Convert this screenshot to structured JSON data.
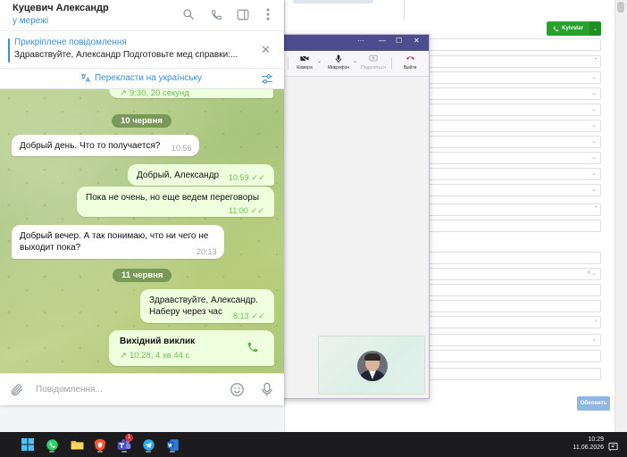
{
  "crm": {
    "call_button_label": "Kyivstar",
    "submit_label": "Обновить"
  },
  "call_window": {
    "title_controls": [
      "···",
      "—",
      "☐",
      "✕"
    ],
    "toolbar": {
      "camera_label": "Камера",
      "mic_label": "Микрофон",
      "share_label": "Поделиться",
      "leave_label": "Выйти"
    }
  },
  "telegram": {
    "header": {
      "contact_name": "Куцевич Александр",
      "status": "у мережі"
    },
    "pinned": {
      "title": "Прикріплене повідомлення",
      "text": "Здравствуйте, Александр Подготовьте мед справки:..."
    },
    "translate_label": "Перекласти на українську",
    "partial_call_info": "9:30, 20 секунд",
    "dates": [
      "10 червня",
      "11 червня"
    ],
    "messages": [
      {
        "text": "Добрый день. Что то получается?",
        "time": "10:56"
      },
      {
        "text": "Добрый, Александр",
        "time": "10:59"
      },
      {
        "text": "Пока не очень, но еще ведем переговоры",
        "time": "11:00"
      },
      {
        "line1": "Добрый вечер. А так понимаю, что ни чего не",
        "line2": "выходит пока?",
        "time": "20:13"
      },
      {
        "line1": "Здравствуйте, Александр.",
        "line2": "Наберу через час",
        "time": "8:13"
      }
    ],
    "call": {
      "title": "Вихідний виклик",
      "info": "10:28, 4 хв 44 с"
    },
    "input_placeholder": "Повідомлення..."
  },
  "taskbar": {
    "teams_badge": "1",
    "time": "10:29",
    "date": "11.06.2026"
  },
  "colors": {
    "telegram_accent": "#3a8fd6",
    "outgoing_bubble": "#eeffde",
    "read_check": "#6cbf55",
    "teams_title": "#4b4d8f",
    "call_green": "#27a22d"
  }
}
